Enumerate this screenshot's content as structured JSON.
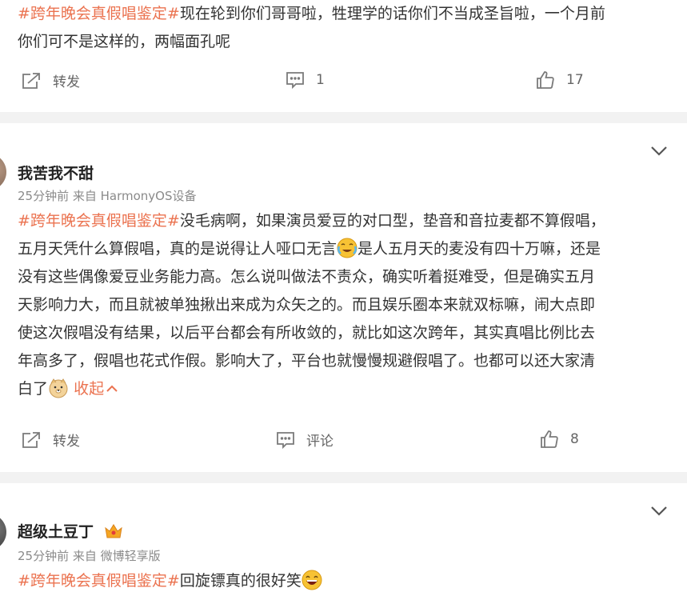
{
  "post1": {
    "tag": "#跨年晚会真假唱鉴定#",
    "line1": "现在轮到你们哥哥啦，牲理学的话你们不当成圣旨啦，一个月前",
    "line2": "你们可不是这样的，两幅面孔呢",
    "repost_label": "转发",
    "comment_count": "1",
    "like_count": "17"
  },
  "post2": {
    "username": "我苦我不甜",
    "meta": "25分钟前  来自 HarmonyOS设备",
    "tag": "#跨年晚会真假唱鉴定#",
    "line1": "没毛病啊，如果演员爱豆的对口型，垫音和音拉麦都不算假唱，",
    "line2a": "五月天凭什么算假唱，真的是说得让人哑口无言",
    "line2b": "是人五月天的麦没有四十万嘛，还是",
    "line3": "没有这些偶像爱豆业务能力高。怎么说叫做法不责众，确实听着挺难受，但是确实五月",
    "line4": "天影响力大，而且就被单独揪出来成为众矢之的。而且娱乐圈本来就双标嘛，闹大点即",
    "line5": "使这次假唱没有结果，以后平台都会有所收敛的，就比如这次跨年，其实真唱比例比去",
    "line6": "年高多了，假唱也花式作假。影响大了，平台也就慢慢规避假唱了。也都可以还大家清",
    "line7": "白了",
    "collapse_label": "收起",
    "repost_label": "转发",
    "comment_label": "评论",
    "like_count": "8"
  },
  "post3": {
    "username": "超级土豆丁",
    "meta": "25分钟前  来自 微博轻享版",
    "tag": "#跨年晚会真假唱鉴定#",
    "text": "回旋镖真的很好笑"
  },
  "colors": {
    "accent": "#eb7350",
    "separator": "#f2f2f2",
    "crown": "#f5a623"
  },
  "icons": [
    "repost-icon",
    "comment-icon",
    "like-icon",
    "chevron-down-icon",
    "crying-laugh-emoji",
    "doge-emoji",
    "grin-emoji",
    "crown-icon"
  ]
}
